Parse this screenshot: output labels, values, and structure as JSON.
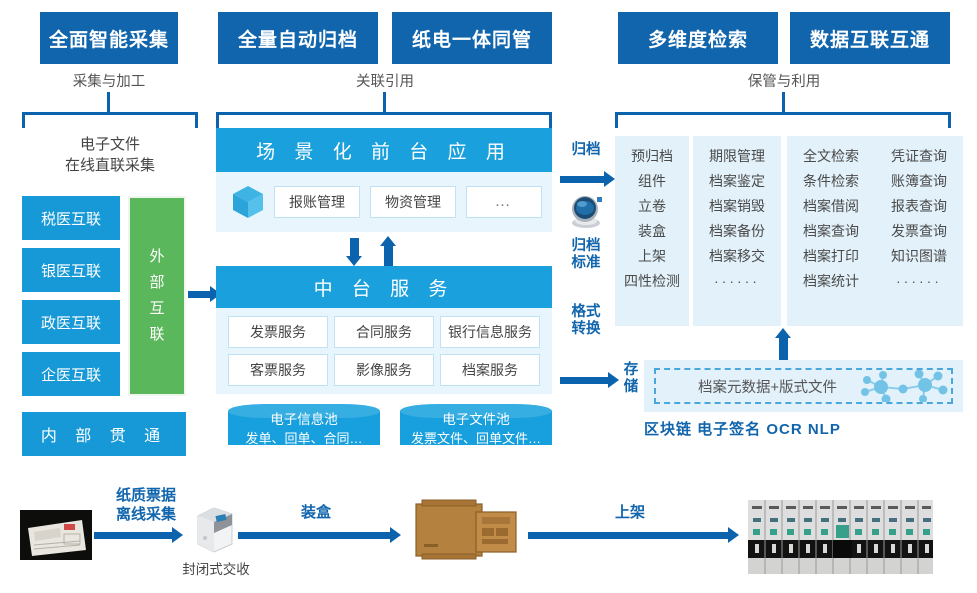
{
  "theme": {
    "header_blue": "#1165ad",
    "panel_blue": "#1aa0dc",
    "box_blue": "#1699d6",
    "green": "#5bb75b",
    "light_panel": "#e8f5fc",
    "right_panel": "#e2f1fa",
    "arrow_blue": "#0b63ad"
  },
  "headers": [
    {
      "label": "全面智能采集",
      "group": "采集与加工"
    },
    {
      "label": "全量自动归档",
      "group": "关联引用"
    },
    {
      "label": "纸电一体同管",
      "group": ""
    },
    {
      "label": "多维度检索",
      "group": "保管与利用"
    },
    {
      "label": "数据互联互通",
      "group": ""
    }
  ],
  "group_labels": {
    "left": "采集与加工",
    "center": "关联引用",
    "right": "保管与利用"
  },
  "left": {
    "caption_line1": "电子文件",
    "caption_line2": "在线直联采集",
    "channels": [
      "税医互联",
      "银医互联",
      "政医互联",
      "企医互联"
    ],
    "external": [
      "外",
      "部",
      "互",
      "联"
    ],
    "internal": "内 部 贯 通"
  },
  "center": {
    "front_title": "场 景 化 前 台 应 用",
    "front_icon": "cube-icon",
    "front_apps": [
      "报账管理",
      "物资管理",
      "…"
    ],
    "mid_title": "中 台 服 务",
    "services": [
      "发票服务",
      "合同服务",
      "银行信息服务",
      "客票服务",
      "影像服务",
      "档案服务"
    ],
    "pools": [
      {
        "title": "电子信息池",
        "desc": "发单、回单、合同…"
      },
      {
        "title": "电子文件池",
        "desc": "发票文件、回单文件…"
      }
    ]
  },
  "connectors": {
    "archive": "归档",
    "archive_standard_l1": "归档",
    "archive_standard_l2": "标准",
    "format_l1": "格式",
    "format_l2": "转换",
    "storage_l1": "存",
    "storage_l2": "储",
    "globe_icon": "globe-icon"
  },
  "right": {
    "columns": [
      [
        "预归档",
        "组件",
        "立卷",
        "装盒",
        "上架",
        "四性检测"
      ],
      [
        "期限管理",
        "档案鉴定",
        "档案销毁",
        "档案备份",
        "档案移交",
        "······"
      ],
      [
        "全文检索",
        "条件检索",
        "档案借阅",
        "档案查询",
        "档案打印",
        "档案统计"
      ],
      [
        "凭证查询",
        "账簿查询",
        "报表查询",
        "发票查询",
        "知识图谱",
        "······"
      ]
    ],
    "storage_box_text": "档案元数据+版式文件",
    "storage_icon": "node-graph-icon",
    "tech_tags": "区块链  电子签名  OCR  NLP"
  },
  "bottom": {
    "steps": [
      {
        "label_l1": "纸质票据",
        "label_l2": "离线采集"
      },
      {
        "label_l1": "装盒",
        "label_l2": ""
      },
      {
        "label_l1": "上架",
        "label_l2": ""
      }
    ],
    "scanner_caption": "封闭式交收",
    "icons": {
      "paper": "paper-documents-photo",
      "scanner": "scanner-device-icon",
      "carton": "carton-box-icon",
      "shelf": "archive-shelf-icon"
    }
  }
}
